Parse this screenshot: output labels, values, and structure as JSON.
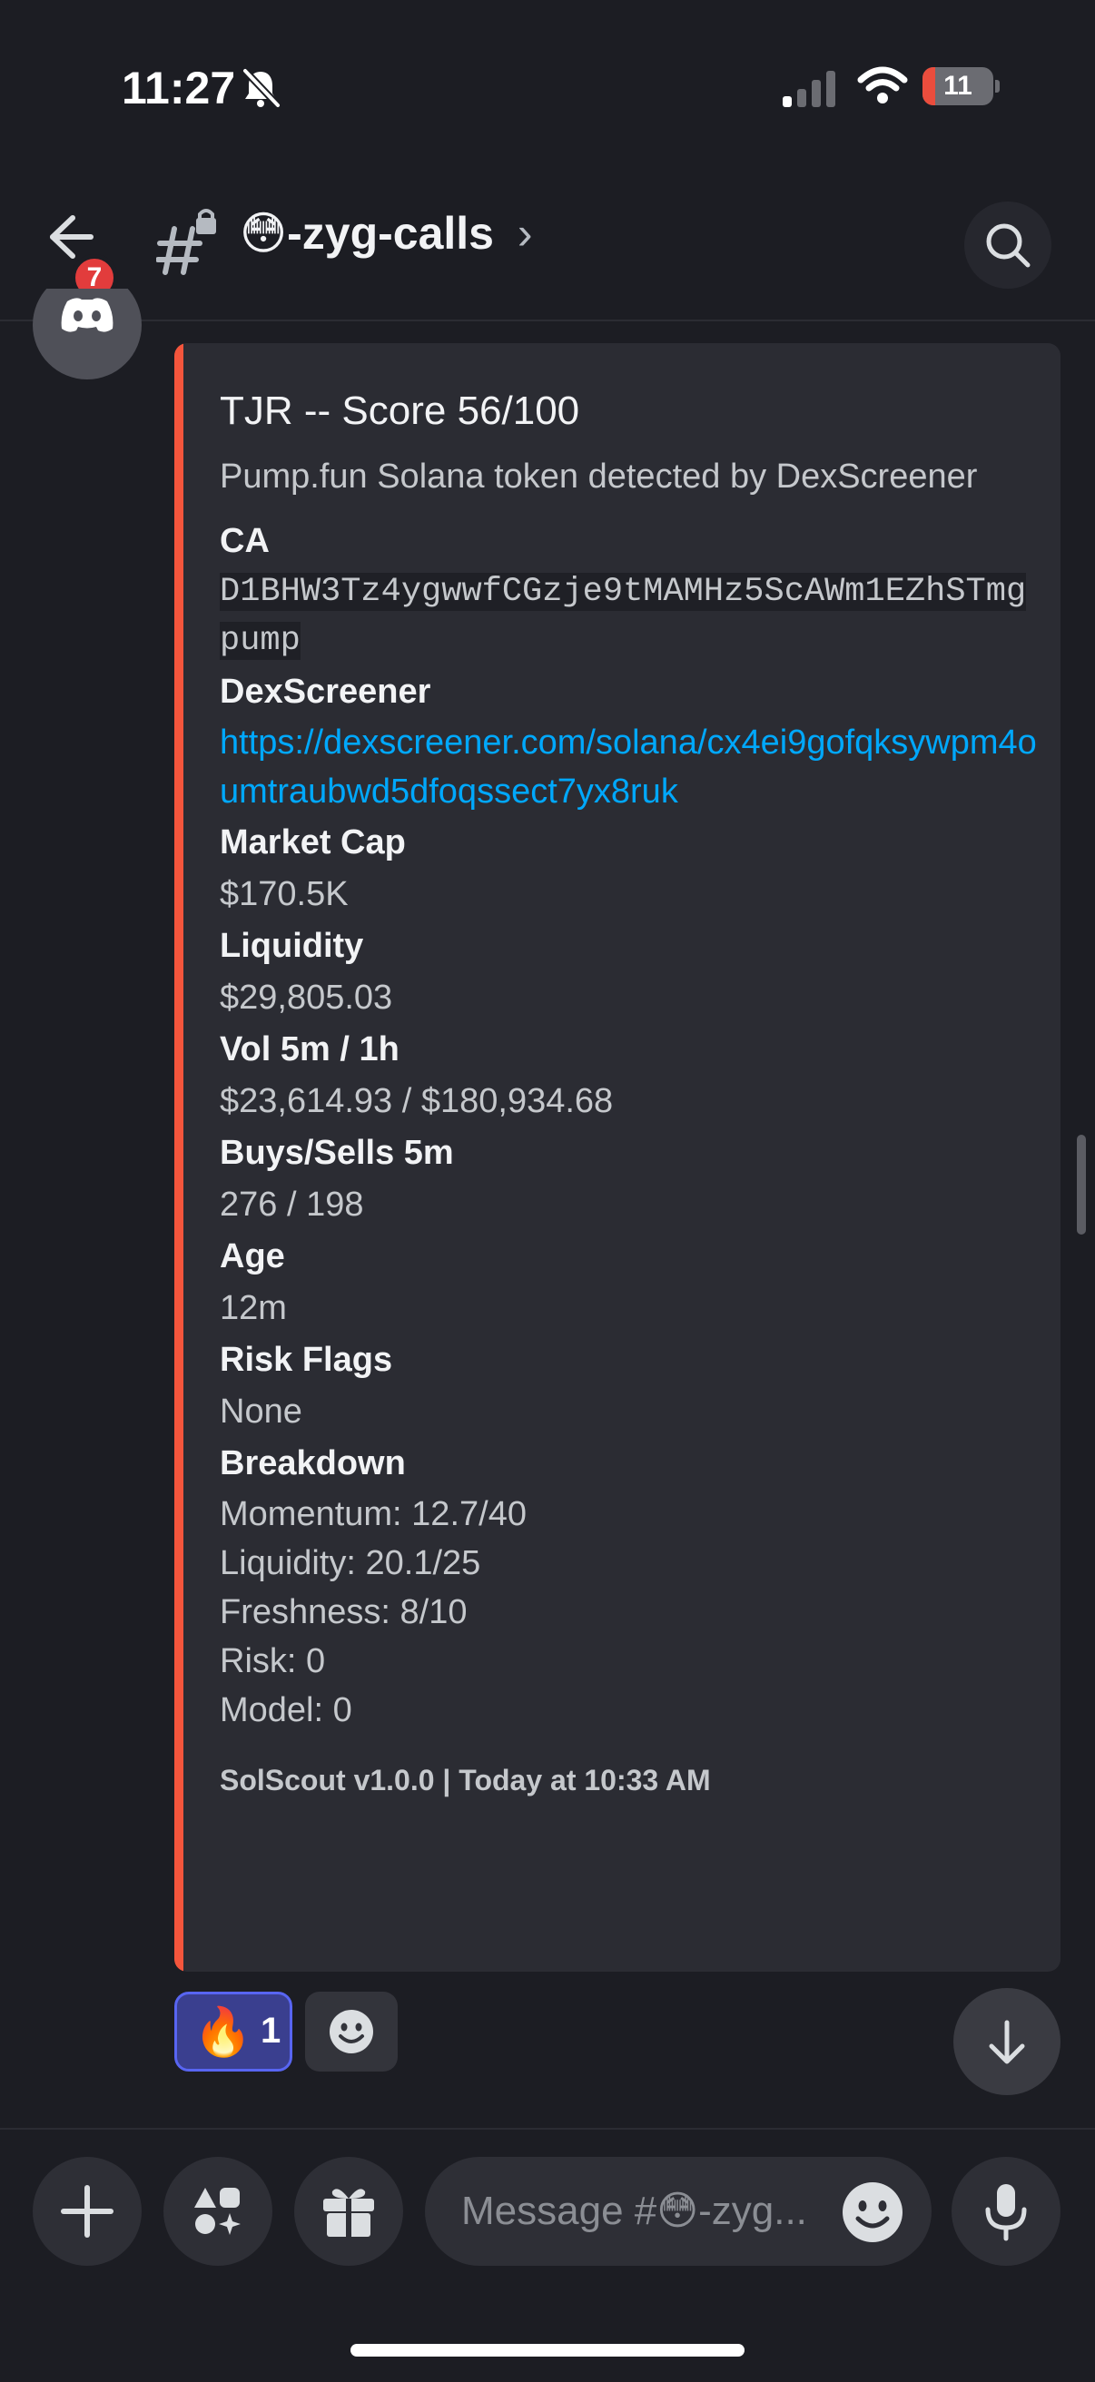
{
  "status_bar": {
    "time": "11:27",
    "battery": "11"
  },
  "header": {
    "unread_count": "7",
    "channel_name": "😳-zyg-calls",
    "chevron": "›"
  },
  "embed": {
    "accent_color": "#f4553c",
    "title": "TJR -- Score 56/100",
    "description": "Pump.fun Solana token detected by DexScreener",
    "fields": {
      "ca": {
        "name": "CA",
        "value": "D1BHW3Tz4ygwwfCGzje9tMAMHz5ScAWm1EZhSTmgpump"
      },
      "dexscreener": {
        "name": "DexScreener",
        "value": "https://dexscreener.com/solana/cx4ei9gofqksywpm4oumtraubwd5dfoqssect7yx8ruk"
      },
      "market_cap": {
        "name": "Market Cap",
        "value": "$170.5K"
      },
      "liquidity": {
        "name": "Liquidity",
        "value": "$29,805.03"
      },
      "volume": {
        "name": "Vol 5m / 1h",
        "value": "$23,614.93 / $180,934.68"
      },
      "buys_sells": {
        "name": "Buys/Sells 5m",
        "value": "276 / 198"
      },
      "age": {
        "name": "Age",
        "value": "12m"
      },
      "risk_flags": {
        "name": "Risk Flags",
        "value": "None"
      },
      "breakdown": {
        "name": "Breakdown",
        "lines": [
          "Momentum: 12.7/40",
          "Liquidity: 20.1/25",
          "Freshness: 8/10",
          "Risk: 0",
          "Model: 0"
        ]
      }
    },
    "footer": "SolScout v1.0.0 | Today at 10:33 AM"
  },
  "reactions": [
    {
      "emoji": "🔥",
      "count": "1",
      "selected": true
    }
  ],
  "composer": {
    "placeholder": "Message #😳-zyg..."
  },
  "icons": {
    "status": [
      "bell-slash-icon",
      "cellular-signal-icon",
      "wifi-icon",
      "battery-icon"
    ],
    "header": [
      "back-arrow-icon",
      "locked-channel-hash-icon",
      "search-icon"
    ],
    "bottom": [
      "plus-icon",
      "apps-icon",
      "gift-icon",
      "emoji-icon",
      "microphone-icon"
    ],
    "other": [
      "discord-logo-icon",
      "add-reaction-icon",
      "arrow-down-icon"
    ]
  }
}
